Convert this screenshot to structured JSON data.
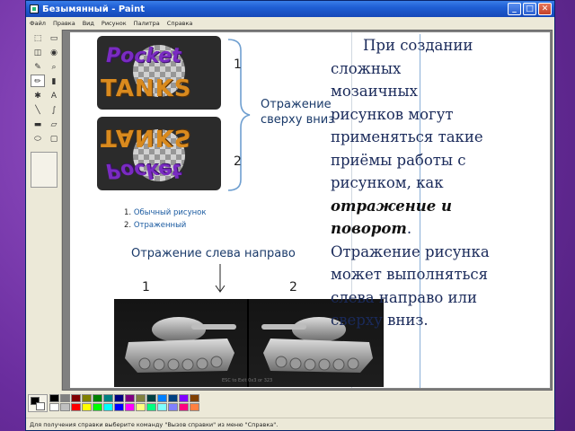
{
  "window": {
    "title": "Безымянный - Paint",
    "buttons": {
      "minimize": "_",
      "maximize": "□",
      "close": "✕"
    }
  },
  "menu": [
    "Файл",
    "Правка",
    "Вид",
    "Рисунок",
    "Палитра",
    "Справка"
  ],
  "tools": [
    {
      "icon": "free-select-icon",
      "glyph": "⬚"
    },
    {
      "icon": "rect-select-icon",
      "glyph": "▭"
    },
    {
      "icon": "eraser-icon",
      "glyph": "◫"
    },
    {
      "icon": "fill-icon",
      "glyph": "◉"
    },
    {
      "icon": "picker-icon",
      "glyph": "✎"
    },
    {
      "icon": "magnifier-icon",
      "glyph": "⌕"
    },
    {
      "icon": "pencil-icon",
      "glyph": "✏"
    },
    {
      "icon": "brush-icon",
      "glyph": "▮"
    },
    {
      "icon": "airbrush-icon",
      "glyph": "✱"
    },
    {
      "icon": "text-icon",
      "glyph": "A"
    },
    {
      "icon": "line-icon",
      "glyph": "╲"
    },
    {
      "icon": "curve-icon",
      "glyph": "∫"
    },
    {
      "icon": "rectangle-icon",
      "glyph": "▬"
    },
    {
      "icon": "polygon-icon",
      "glyph": "▱"
    },
    {
      "icon": "ellipse-icon",
      "glyph": "⬭"
    },
    {
      "icon": "rounded-rect-icon",
      "glyph": "▢"
    }
  ],
  "palette": {
    "row1": [
      "#000000",
      "#808080",
      "#800000",
      "#808000",
      "#008000",
      "#008080",
      "#000080",
      "#800080",
      "#808040",
      "#004040",
      "#0080ff",
      "#004080",
      "#8000ff",
      "#804000"
    ],
    "row2": [
      "#ffffff",
      "#c0c0c0",
      "#ff0000",
      "#ffff00",
      "#00ff00",
      "#00ffff",
      "#0000ff",
      "#ff00ff",
      "#ffff80",
      "#00ff80",
      "#80ffff",
      "#8080ff",
      "#ff0080",
      "#ff8040"
    ]
  },
  "statusbar": "Для получения справки выберите команду \"Вызов справки\" из меню \"Справка\".",
  "slide": {
    "logo_text_top": "Pocket",
    "logo_text_bottom": "TANKS",
    "number_1": "1",
    "number_2": "2",
    "label_vertical": "Отражение\nсверху вниз",
    "list": [
      {
        "n": "1.",
        "text": "Обычный рисунок"
      },
      {
        "n": "2.",
        "text": "Отраженный"
      }
    ],
    "label_horizontal": "Отражение слева направо",
    "tank_num_1": "1",
    "tank_num_2": "2",
    "tank_caption": "ESC to Exit    0x3 or 323",
    "body_part1": "При создании сложных мозаичных рисунков  могут применяться такие приёмы работы с рисунком, как ",
    "body_bold": "отражение",
    "body_and": " и ",
    "body_bold2": "поворот",
    "body_part2": ". Отражение рисунка может выполняться слева направо или сверху вниз."
  }
}
